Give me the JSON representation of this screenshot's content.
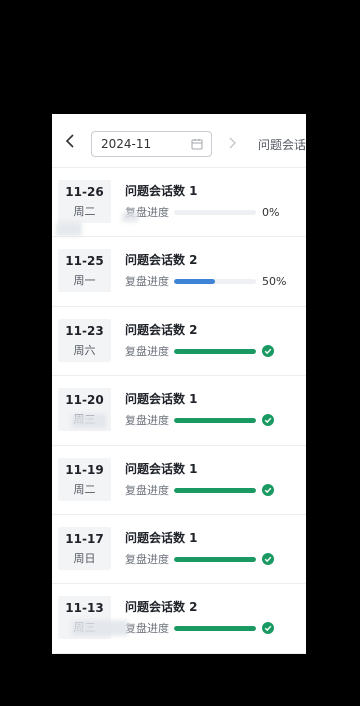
{
  "header": {
    "month": "2024-11",
    "metric_tab": "问题会话"
  },
  "colors": {
    "done": "#1a9a62",
    "partial": "#3d83d6",
    "track": "#eef0f3"
  },
  "rows": [
    {
      "date": "11-26",
      "weekday": "周二",
      "title": "问题会话数 1",
      "progress_label": "复盘进度",
      "progress": 0,
      "progress_text": "0%",
      "status": "pending"
    },
    {
      "date": "11-25",
      "weekday": "周一",
      "title": "问题会话数 2",
      "progress_label": "复盘进度",
      "progress": 0.5,
      "progress_text": "50%",
      "status": "partial"
    },
    {
      "date": "11-23",
      "weekday": "周六",
      "title": "问题会话数 2",
      "progress_label": "复盘进度",
      "progress": 1,
      "progress_text": "",
      "status": "done"
    },
    {
      "date": "11-20",
      "weekday": "周三",
      "title": "问题会话数 1",
      "progress_label": "复盘进度",
      "progress": 1,
      "progress_text": "",
      "status": "done"
    },
    {
      "date": "11-19",
      "weekday": "周二",
      "title": "问题会话数 1",
      "progress_label": "复盘进度",
      "progress": 1,
      "progress_text": "",
      "status": "done"
    },
    {
      "date": "11-17",
      "weekday": "周日",
      "title": "问题会话数 1",
      "progress_label": "复盘进度",
      "progress": 1,
      "progress_text": "",
      "status": "done"
    },
    {
      "date": "11-13",
      "weekday": "周三",
      "title": "问题会话数 2",
      "progress_label": "复盘进度",
      "progress": 1,
      "progress_text": "",
      "status": "done"
    }
  ]
}
